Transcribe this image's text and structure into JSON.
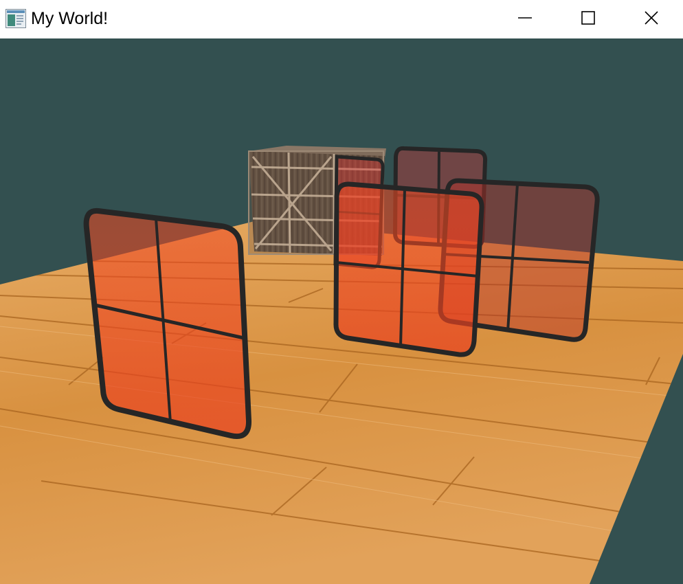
{
  "window": {
    "title": "My World!",
    "controls": [
      "minimize",
      "maximize",
      "close"
    ]
  },
  "scene": {
    "clear_color": "#335050",
    "floor_color": "#d9913f",
    "crate_color": "#6e5a48",
    "window_tint": "#e8401f",
    "frame_color": "#262626",
    "icons": {
      "app": "app-window-icon",
      "minimize": "minimize-icon",
      "maximize": "maximize-icon",
      "close": "close-icon"
    }
  }
}
